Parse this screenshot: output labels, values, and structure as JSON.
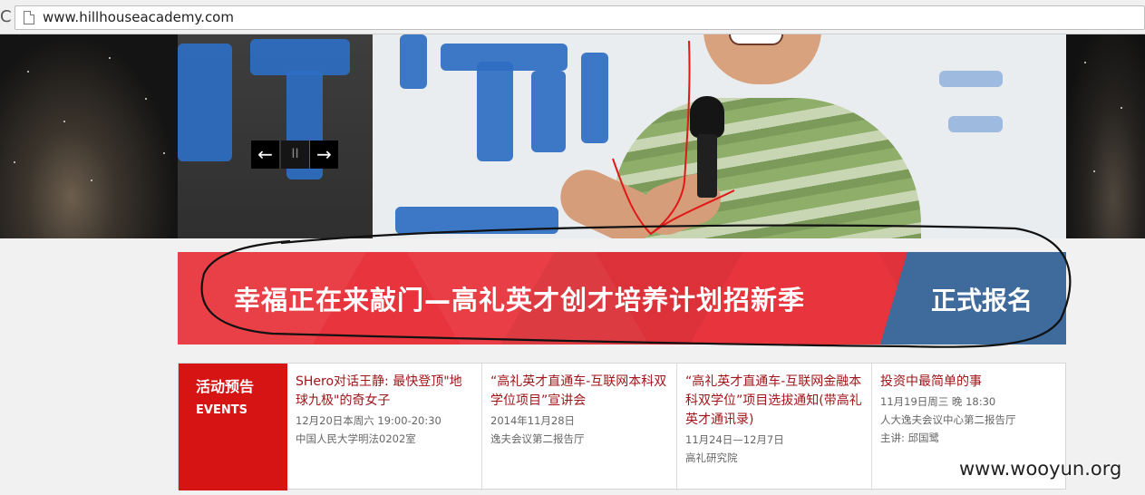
{
  "browser": {
    "url": "www.hillhouseacademy.com"
  },
  "slider": {
    "prev_icon": "arrow-left-icon",
    "pause_icon": "pause-icon",
    "next_icon": "arrow-right-icon",
    "prev_glyph": "←",
    "pause_glyph": "II",
    "next_glyph": "→"
  },
  "banner": {
    "title": "幸福正在来敲门—高礼英才创才培养计划招新季",
    "register_label": "正式报名",
    "colors": {
      "red": "#e8343c",
      "blue": "#3e6a9c"
    }
  },
  "events": {
    "label_cn": "活动预告",
    "label_en": "EVENTS",
    "items": [
      {
        "title": "SHero对话王静: 最快登顶\"地球九极\"的奇女子",
        "time": "12月20日本周六 19:00-20:30",
        "place": "中国人民大学明法0202室"
      },
      {
        "title": "“高礼英才直通车-互联网本科双学位项目”宣讲会",
        "time": "2014年11月28日",
        "place": "逸夫会议第二报告厅"
      },
      {
        "title": "“高礼英才直通车-互联网金融本科双学位”项目选拔通知(带高礼英才通讯录)",
        "time": "11月24日—12月7日",
        "place": "高礼研究院"
      },
      {
        "title": "投资中最简单的事",
        "time": "11月19日周三 晚 18:30",
        "place": "人大逸夫会议中心第二报告厅",
        "host": "主讲: 邱国鹭"
      }
    ]
  },
  "watermark": "www.wooyun.org"
}
